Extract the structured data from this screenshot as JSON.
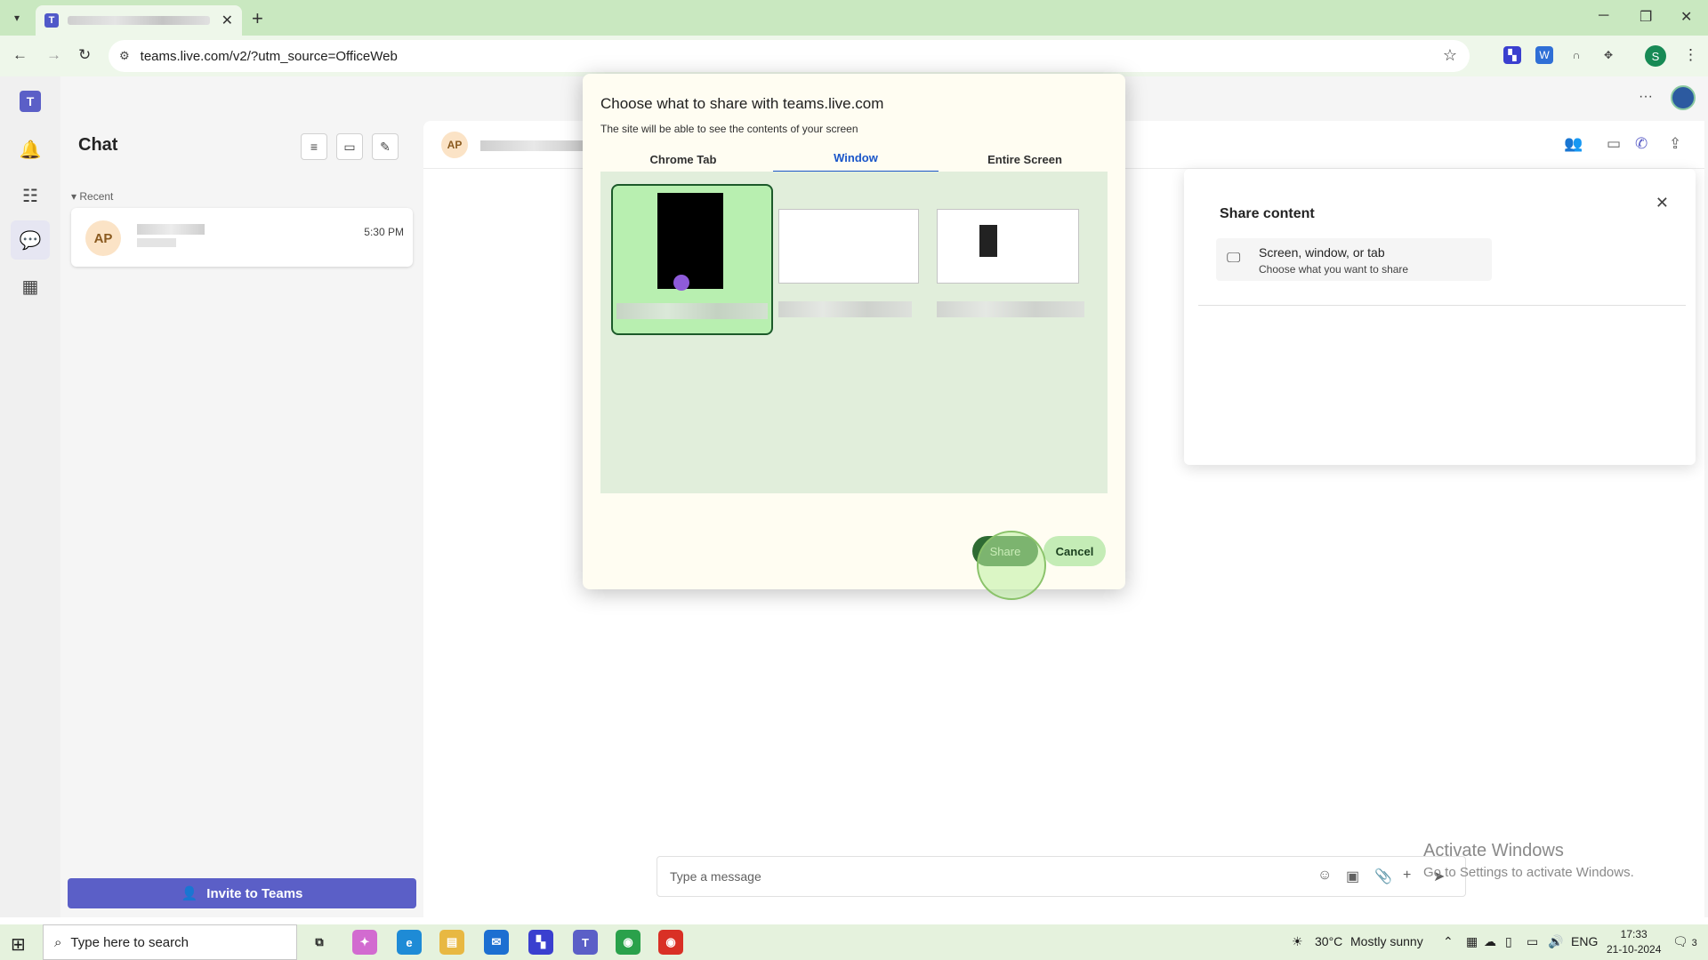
{
  "browser": {
    "tab_new": "+",
    "tab_close": "✕",
    "url": "teams.live.com/v2/?utm_source=OfficeWeb",
    "profile_initial": "S"
  },
  "rail": {
    "logo": "T"
  },
  "chat_pane": {
    "title": "Chat",
    "recent_label": "Recent",
    "item": {
      "initials": "AP",
      "time": "5:30 PM"
    },
    "invite_label": "Invite to Teams"
  },
  "conversation": {
    "header_initials": "AP",
    "composer_placeholder": "Type a message"
  },
  "share_panel": {
    "title": "Share content",
    "option_title": "Screen, window, or tab",
    "option_subtitle": "Choose what you want to share"
  },
  "share_dialog": {
    "title": "Choose what to share with teams.live.com",
    "subtitle": "The site will be able to see the contents of your screen",
    "tabs": [
      {
        "label": "Chrome Tab",
        "active": false
      },
      {
        "label": "Window",
        "active": true
      },
      {
        "label": "Entire Screen",
        "active": false
      }
    ],
    "share_label": "Share",
    "cancel_label": "Cancel"
  },
  "watermark": {
    "line1": "Activate Windows",
    "line2": "Go to Settings to activate Windows."
  },
  "taskbar": {
    "search_placeholder": "Type here to search",
    "weather_temp": "30°C",
    "weather_text": "Mostly sunny",
    "language": "ENG",
    "time": "17:33",
    "date": "21-10-2024",
    "notification_count": "3"
  },
  "colors": {
    "teams_accent": "#5b5fc7",
    "dialog_selected": "#1a56c9",
    "share_button": "#2e6b33"
  }
}
